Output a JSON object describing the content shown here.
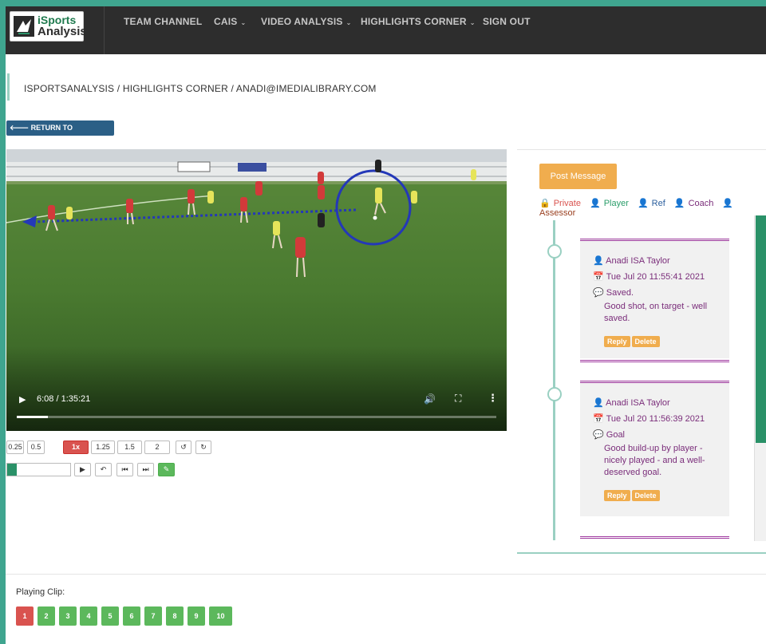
{
  "nav": {
    "logo_line1": "iSports",
    "logo_line2": "Analysis",
    "items": [
      {
        "label": "TEAM CHANNEL",
        "caret": ""
      },
      {
        "label": "CAIS",
        "caret": "⌄"
      },
      {
        "label": "VIDEO ANALYSIS",
        "caret": "⌄"
      },
      {
        "label": "HIGHLIGHTS CORNER",
        "caret": "⌄"
      },
      {
        "label": "SIGN OUT",
        "caret": ""
      }
    ]
  },
  "breadcrumb": "ISPORTSANALYSIS / HIGHLIGHTS CORNER / ANADI@IMEDIALIBRARY.COM",
  "return_button": "RETURN TO HIGHLIGHTS",
  "video": {
    "time": "6:08 / 1:35:21",
    "progress": 0.065,
    "play_icon": "▶",
    "volume_icon": "🔊",
    "fullscreen_icon": "⛶",
    "more_icon": "⋮"
  },
  "speeds": [
    {
      "label": "0.25",
      "active": false
    },
    {
      "label": "0.5",
      "active": false
    },
    {
      "label": "1x",
      "active": true
    },
    {
      "label": "1.25",
      "active": false
    },
    {
      "label": "1.5",
      "active": false
    },
    {
      "label": "2",
      "active": false
    }
  ],
  "controls": {
    "rotate_left": "↺",
    "rotate_right": "↻",
    "play": "▶",
    "undo": "↶",
    "prev": "⏮",
    "next": "⏭",
    "edit": "✎",
    "clip_progress": 0.15
  },
  "panel": {
    "post_button": "Post Message",
    "legend": [
      {
        "icon": "lock-icon",
        "label": "Private",
        "cls": "lg-private"
      },
      {
        "icon": "user-icon",
        "label": "Player",
        "cls": "lg-player"
      },
      {
        "icon": "user-icon",
        "label": "Ref",
        "cls": "lg-ref"
      },
      {
        "icon": "user-icon",
        "label": "Coach",
        "cls": "lg-coach"
      },
      {
        "icon": "user-icon",
        "label": "Assessor",
        "cls": "lg-assessor"
      }
    ],
    "messages": [
      {
        "author": "Anadi ISA Taylor",
        "date": "Tue Jul 20 11:55:41 2021",
        "title": "Saved.",
        "text": "Good shot, on target - well saved.",
        "reply": "Reply",
        "delete": "Delete"
      },
      {
        "author": "Anadi ISA Taylor",
        "date": "Tue Jul 20 11:56:39 2021",
        "title": "Goal",
        "text": "Good build-up by player - nicely played - and a well-deserved goal.",
        "reply": "Reply",
        "delete": "Delete"
      }
    ]
  },
  "playing_clip": {
    "label": "Playing Clip:",
    "clips": [
      "1",
      "2",
      "3",
      "4",
      "5",
      "6",
      "7",
      "8",
      "9",
      "10"
    ],
    "active": "1"
  },
  "colors": {
    "accent_green": "#2a9168",
    "danger": "#d9534f",
    "warning": "#f0ad4e",
    "nav_bg": "#2d2d2d",
    "message_purple": "#7a2d7a"
  }
}
